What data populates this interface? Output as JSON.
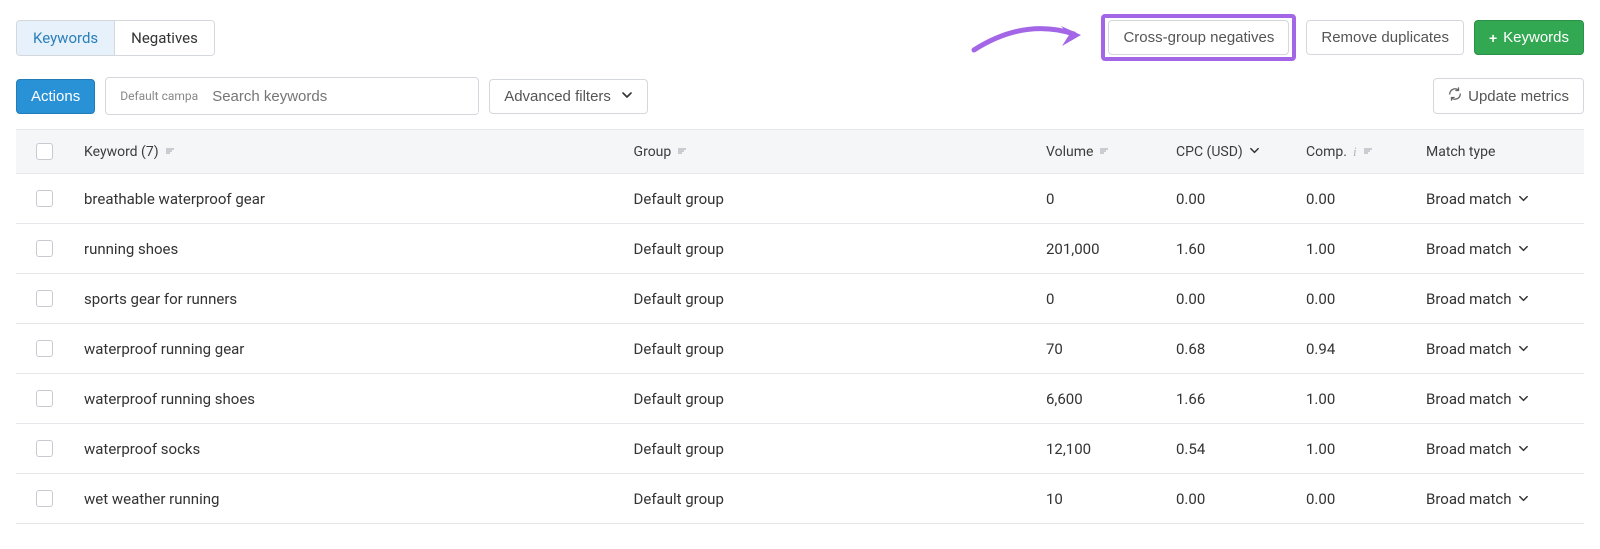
{
  "tabs": {
    "keywords": "Keywords",
    "negatives": "Negatives"
  },
  "top_buttons": {
    "cross_group": "Cross-group negatives",
    "remove_dup": "Remove duplicates",
    "add_keywords": "Keywords"
  },
  "toolbar": {
    "actions": "Actions",
    "campaign_badge": "Default campa",
    "search_placeholder": "Search keywords",
    "advanced_filters": "Advanced filters",
    "update_metrics": "Update metrics"
  },
  "columns": {
    "keyword": "Keyword (7)",
    "group": "Group",
    "volume": "Volume",
    "cpc": "CPC (USD)",
    "comp": "Comp.",
    "match": "Match type"
  },
  "match_label": "Broad match",
  "rows": [
    {
      "keyword": "breathable waterproof gear",
      "group": "Default group",
      "volume": "0",
      "cpc": "0.00",
      "comp": "0.00"
    },
    {
      "keyword": "running shoes",
      "group": "Default group",
      "volume": "201,000",
      "cpc": "1.60",
      "comp": "1.00"
    },
    {
      "keyword": "sports gear for runners",
      "group": "Default group",
      "volume": "0",
      "cpc": "0.00",
      "comp": "0.00"
    },
    {
      "keyword": "waterproof running gear",
      "group": "Default group",
      "volume": "70",
      "cpc": "0.68",
      "comp": "0.94"
    },
    {
      "keyword": "waterproof running shoes",
      "group": "Default group",
      "volume": "6,600",
      "cpc": "1.66",
      "comp": "1.00"
    },
    {
      "keyword": "waterproof socks",
      "group": "Default group",
      "volume": "12,100",
      "cpc": "0.54",
      "comp": "1.00"
    },
    {
      "keyword": "wet weather running",
      "group": "Default group",
      "volume": "10",
      "cpc": "0.00",
      "comp": "0.00"
    }
  ]
}
